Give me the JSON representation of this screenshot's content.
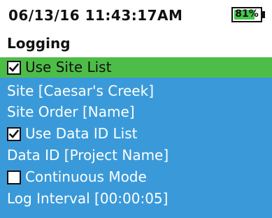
{
  "status": {
    "datetime": "06/13/16  11:43:17AM",
    "battery_label": "81%",
    "battery_level_percent": 81
  },
  "screen_title": "Logging",
  "colors": {
    "selected_bg": "#4dbd47",
    "menu_bg": "#3a9ad9",
    "battery_fill": "#46c64b"
  },
  "menu": {
    "items": [
      {
        "label": "Use Site List",
        "checkbox": true,
        "checked": true,
        "selected": true
      },
      {
        "label": "Site [Caesar's Creek]"
      },
      {
        "label": "Site Order [Name]"
      },
      {
        "label": "Use Data ID List",
        "checkbox": true,
        "checked": true
      },
      {
        "label": "Data ID [Project Name]"
      },
      {
        "label": "Continuous Mode",
        "checkbox": true,
        "checked": false
      },
      {
        "label": "Log Interval [00:00:05]"
      }
    ]
  }
}
